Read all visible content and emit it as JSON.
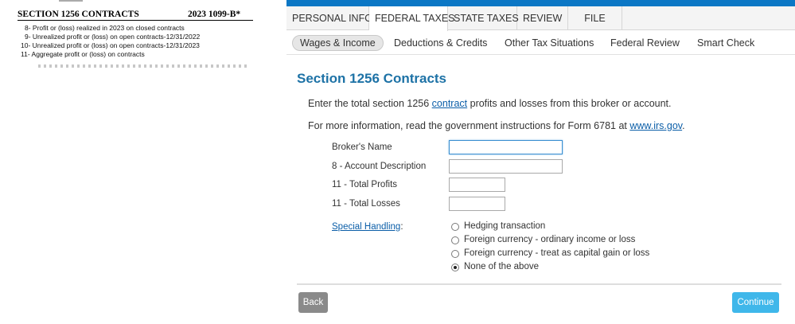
{
  "form": {
    "header_left": "SECTION 1256 CONTRACTS",
    "header_right": "2023 1099-B*",
    "lines": [
      "8- Profit or (loss) realized in 2023 on closed contracts",
      "9- Unrealized profit or (loss) on open contracts-12/31/2022",
      "10- Unrealized profit or (loss) on open contracts-12/31/2023",
      "11- Aggregate profit or (loss) on contracts"
    ]
  },
  "colors": {
    "accent": "#0b77c5",
    "title": "#1d72a6",
    "link": "#0b5ea8",
    "continue": "#3fb7ea",
    "back": "#8a8a8a"
  },
  "tabs": [
    {
      "label": "PERSONAL INFO",
      "active": false
    },
    {
      "label": "FEDERAL TAXES",
      "active": true
    },
    {
      "label": "STATE TAXES",
      "active": false
    },
    {
      "label": "REVIEW",
      "active": false
    },
    {
      "label": "FILE",
      "active": false
    }
  ],
  "subnav": [
    {
      "label": "Wages & Income",
      "active": true
    },
    {
      "label": "Deductions & Credits",
      "active": false
    },
    {
      "label": "Other Tax Situations",
      "active": false
    },
    {
      "label": "Federal Review",
      "active": false
    },
    {
      "label": "Smart Check",
      "active": false
    }
  ],
  "page": {
    "title": "Section 1256 Contracts",
    "intro_before": "Enter the total section 1256 ",
    "intro_link": "contract",
    "intro_after": " profits and losses from this broker or account.",
    "info_before": "For more information, read the government instructions for Form 6781 at ",
    "info_link": "www.irs.gov",
    "info_after": "."
  },
  "fields": {
    "broker_name": {
      "label": "Broker's Name",
      "value": ""
    },
    "account_description": {
      "label": "8 - Account Description",
      "value": ""
    },
    "total_profits": {
      "label": "11 - Total Profits",
      "value": ""
    },
    "total_losses": {
      "label": "11 - Total Losses",
      "value": ""
    }
  },
  "special_handling": {
    "label": "Special Handling",
    "suffix": ":",
    "options": [
      {
        "label": "Hedging transaction",
        "selected": false
      },
      {
        "label": "Foreign currency - ordinary income or loss",
        "selected": false
      },
      {
        "label": "Foreign currency - treat as capital gain or loss",
        "selected": false
      },
      {
        "label": "None of the above",
        "selected": true
      }
    ]
  },
  "buttons": {
    "back": "Back",
    "continue": "Continue"
  }
}
